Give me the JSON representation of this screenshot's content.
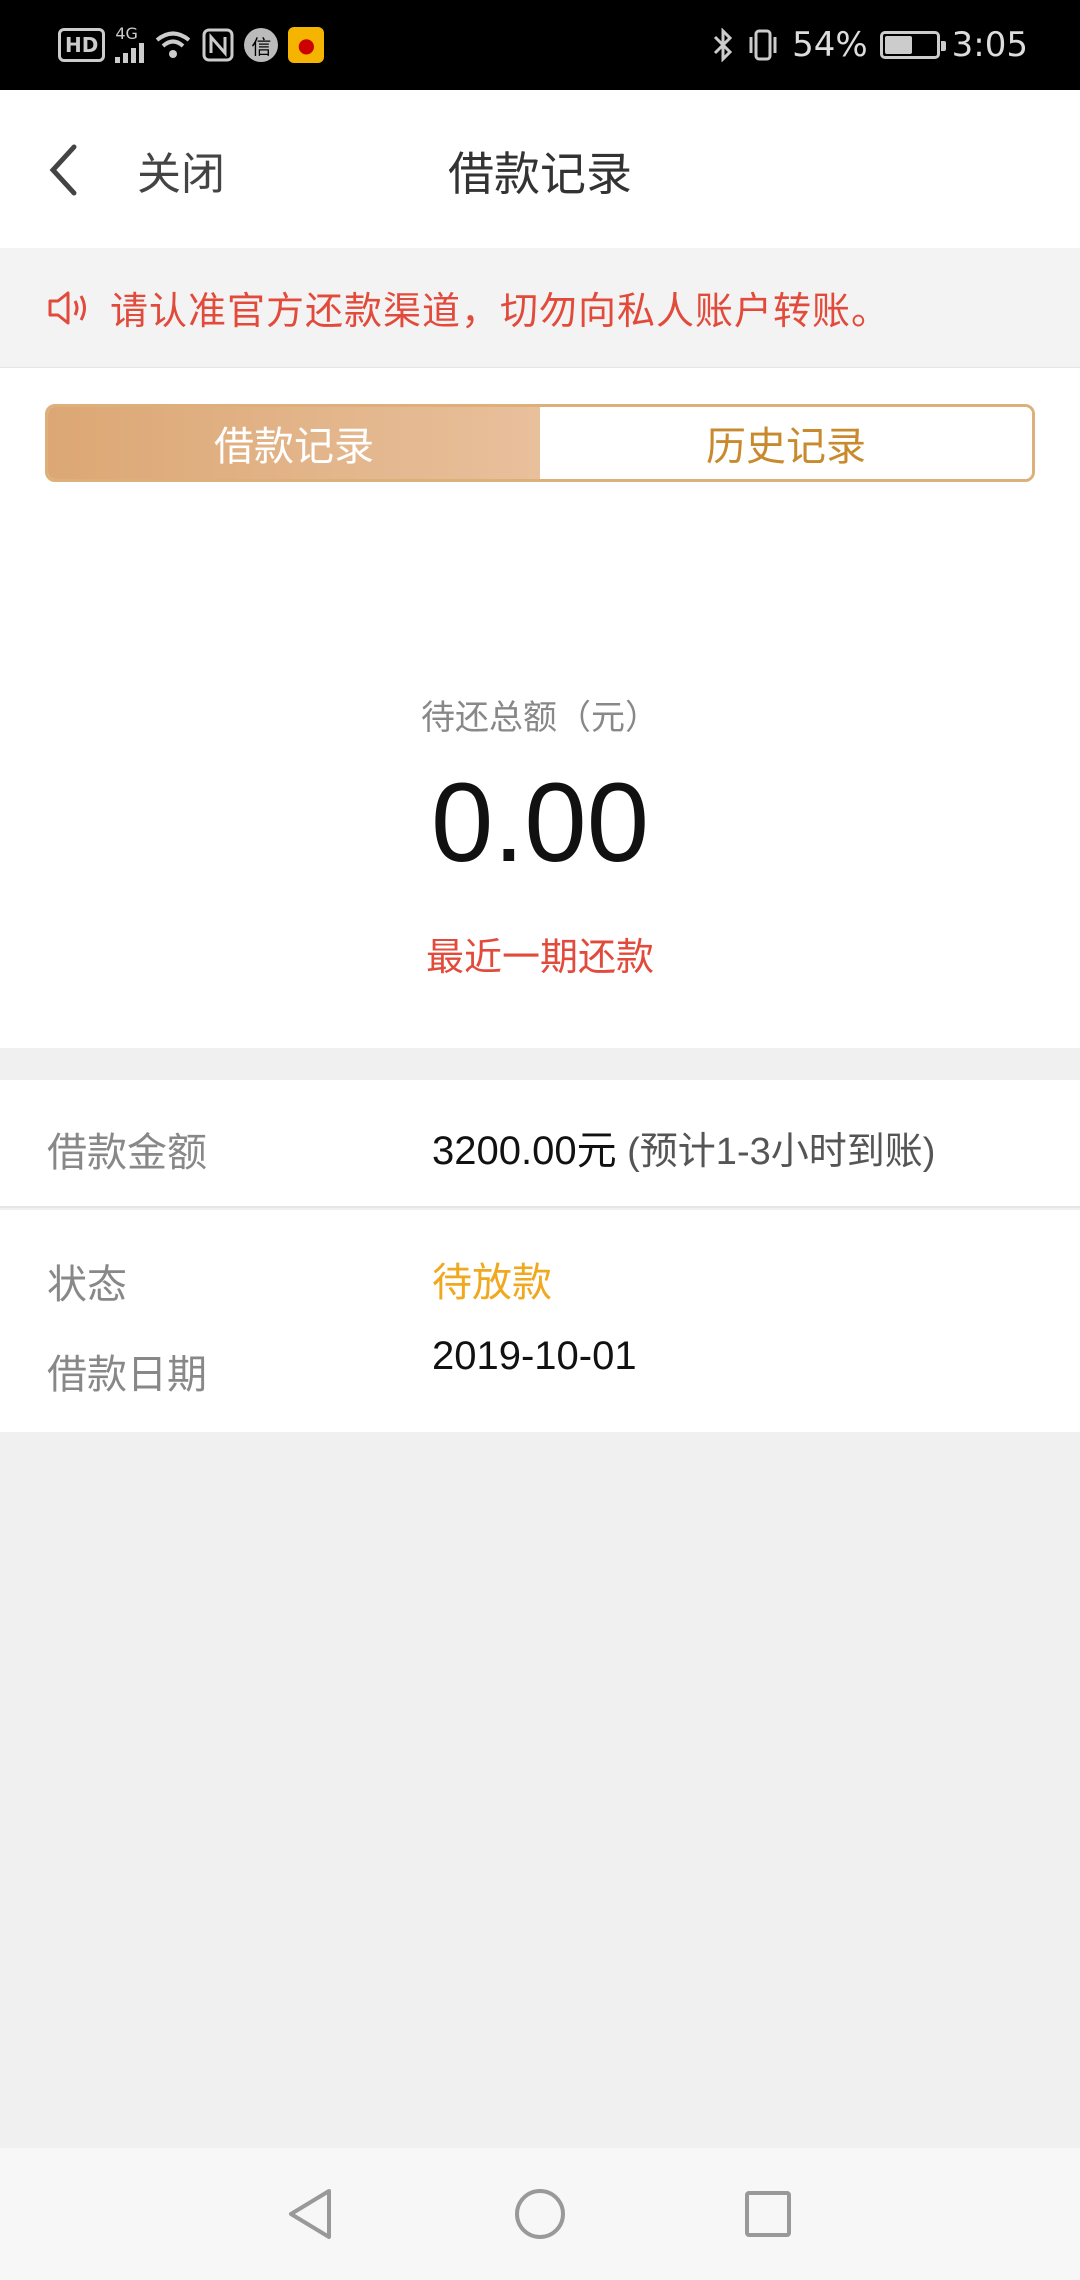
{
  "status_bar": {
    "network_badge": "HD",
    "network_type": "4G",
    "battery_percent": "54%",
    "battery_level": 0.54,
    "time": "3:05",
    "icons": [
      "hd-icon",
      "signal-icon",
      "wifi-icon",
      "nfc-icon",
      "message-icon",
      "app-icon",
      "bluetooth-icon",
      "vibrate-icon",
      "battery-icon"
    ]
  },
  "header": {
    "close_label": "关闭",
    "title": "借款记录"
  },
  "notice": {
    "text": "请认准官方还款渠道，切勿向私人账户转账。"
  },
  "tabs": [
    {
      "label": "借款记录",
      "active": true
    },
    {
      "label": "历史记录",
      "active": false
    }
  ],
  "summary": {
    "amount_label": "待还总额（元）",
    "amount_value": "0.00",
    "recent_link": "最近一期还款"
  },
  "details": {
    "loan_amount_label": "借款金额",
    "loan_amount_value": "3200.00元",
    "loan_amount_note": " (预计1-3小时到账)",
    "status_label": "状态",
    "status_value": "待放款",
    "date_label": "借款日期",
    "date_value": "2019-10-01"
  },
  "colors": {
    "accent_gold": "#dca774",
    "warning_red": "#e24b3b",
    "status_orange": "#f0a81e"
  }
}
